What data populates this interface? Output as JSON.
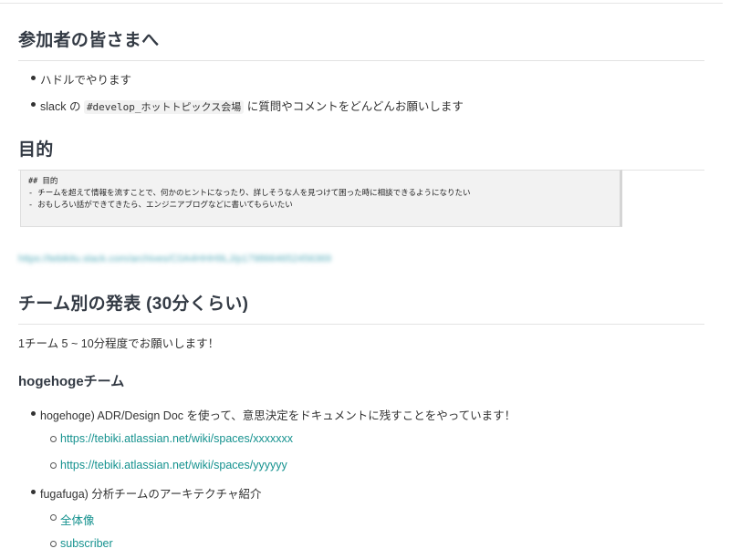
{
  "participants": {
    "heading": "参加者の皆さまへ",
    "items": [
      {
        "text": "ハドルでやります"
      },
      {
        "prefix": "slack の ",
        "code": "#develop_ホットトピックス会場",
        "suffix": " に質問やコメントをどんどんお願いします"
      }
    ]
  },
  "purpose": {
    "heading": "目的",
    "code_lines": [
      "## 目的",
      "- チームを超えて情報を流すことで、何かのヒントになったり、詳しそうな人を見つけて困った時に相談できるようになりたい",
      "- おもしろい話ができてきたら、エンジニアブログなどに書いてもらいたい"
    ],
    "blurred_link": "https://tebikitu.slack.com/archives/C0A4HHH9LJ/p1798664652456369"
  },
  "teams": {
    "heading": "チーム別の発表 (30分くらい)",
    "intro": "1チーム 5 ~ 10分程度でお願いします！",
    "team_heading": "hogehogeチーム",
    "items": [
      {
        "text": "hogehoge) ADR/Design Doc を使って、意思決定をドキュメントに残すことをやっています！",
        "links": [
          "https://tebiki.atlassian.net/wiki/spaces/xxxxxxx",
          "https://tebiki.atlassian.net/wiki/spaces/yyyyyy"
        ]
      },
      {
        "text": "fugafuga) 分析チームのアーキテクチャ紹介",
        "links": [
          "全体像",
          "subscriber"
        ]
      }
    ]
  }
}
